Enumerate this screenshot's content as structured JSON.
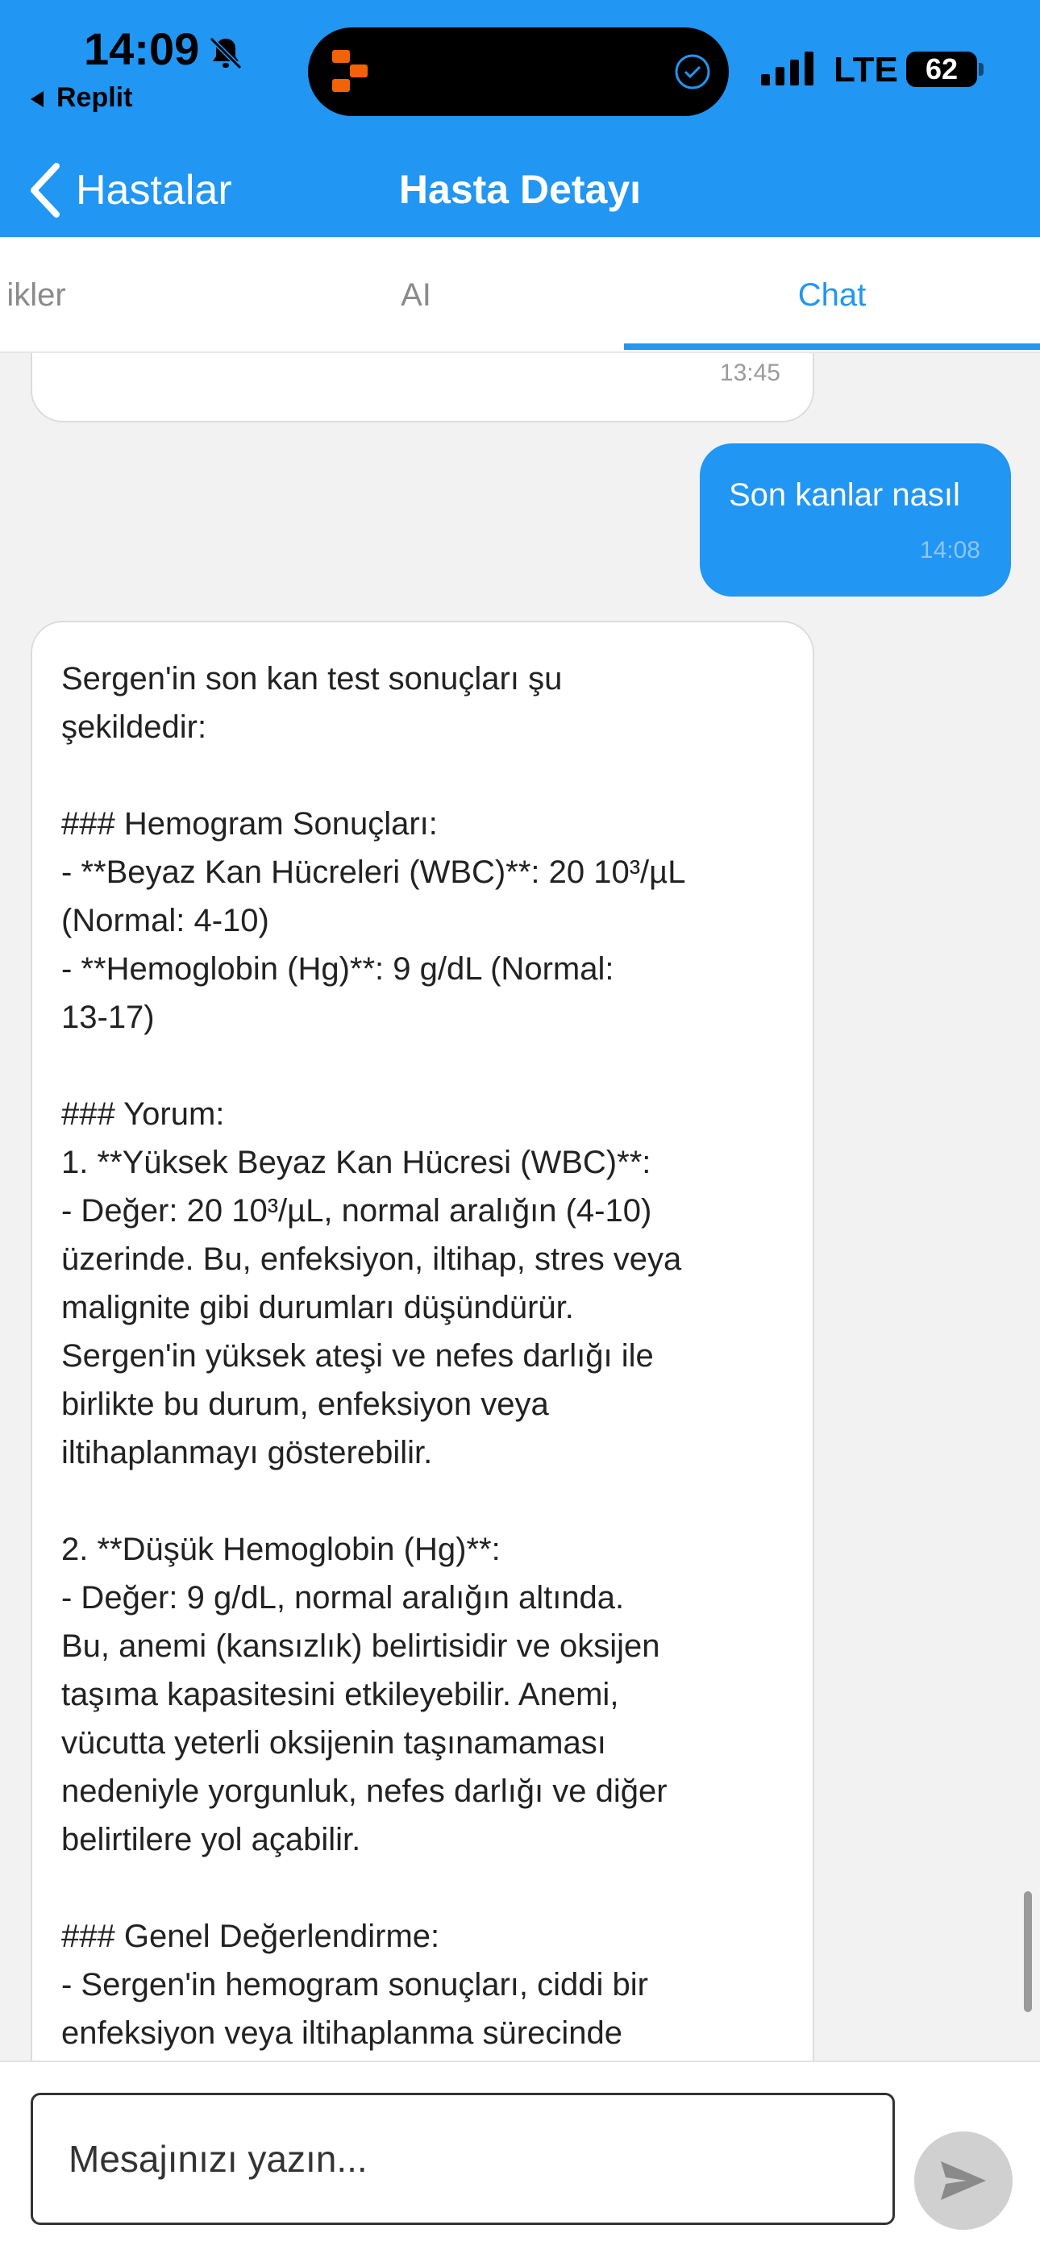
{
  "status_bar": {
    "time": "14:09",
    "back_app": "Replit",
    "network": "LTE",
    "battery": "62"
  },
  "nav": {
    "back_label": "Hastalar",
    "title": "Hasta Detayı"
  },
  "tabs": [
    {
      "label": "ikler"
    },
    {
      "label": "AI"
    },
    {
      "label": "Chat"
    }
  ],
  "colors": {
    "accent": "#2196f3",
    "background": "#f2f2f2"
  },
  "messages": {
    "previous": {
      "time": "13:45"
    },
    "user": {
      "text": "Son kanlar nasıl",
      "time": "14:08"
    },
    "bot": {
      "text": "Sergen'in son kan test sonuçları şu\nşekildedir:\n\n### Hemogram Sonuçları:\n- **Beyaz Kan Hücreleri (WBC)**: 20 10³/µL\n(Normal: 4-10)\n- **Hemoglobin (Hg)**: 9 g/dL (Normal:\n13-17)\n\n### Yorum:\n1. **Yüksek Beyaz Kan Hücresi (WBC)**:\n   - Değer: 20 10³/µL, normal aralığın (4-10)\nüzerinde. Bu, enfeksiyon, iltihap, stres veya\nmalignite gibi durumları düşündürür.\nSergen'in yüksek ateşi ve nefes darlığı ile\nbirlikte bu durum, enfeksiyon veya\niltihaplanmayı gösterebilir.\n\n2. **Düşük Hemoglobin (Hg)**:\n   - Değer: 9 g/dL, normal aralığın altında.\nBu, anemi (kansızlık) belirtisidir ve oksijen\ntaşıma kapasitesini etkileyebilir. Anemi,\nvücutta yeterli oksijenin taşınamaması\nnedeniyle yorgunluk, nefes darlığı ve diğer\nbelirtilere yol açabilir.\n\n### Genel Değerlendirme:\n- Sergen'in hemogram sonuçları, ciddi bir\nenfeksiyon veya iltihaplanma sürecinde"
    }
  },
  "input": {
    "placeholder": "Mesajınızı yazın..."
  }
}
